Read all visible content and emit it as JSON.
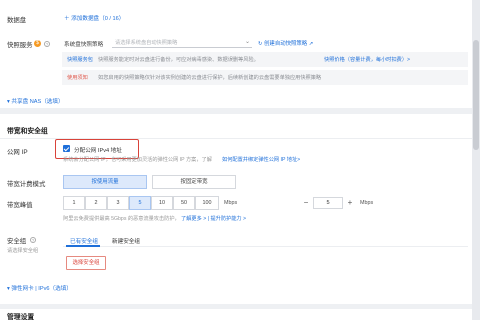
{
  "data_disk": {
    "label": "数据盘",
    "add_button": "添加数据盘（0 / 16）"
  },
  "snapshot": {
    "label": "快照服务",
    "select_label": "系统盘快照策略",
    "select_placeholder": "请选择系统盘自动快照策略",
    "create_link": "创建自动快照策略",
    "note1_tag": "快照服务包",
    "note1_text": "快照服务能定时对云盘进行备份，可应对病毒感染、数据误删等风险。",
    "note1_link": "快照价格（容量计费，每小时扣费）>",
    "note2_tag": "使用须知",
    "note2_text": "如您启用的快照策略仅针对该实例创建的云盘进行保护，后续新创建的云盘需要单独应用快照策略"
  },
  "shared_nas": {
    "label": "共享盘 NAS（选填）"
  },
  "bandwidth": {
    "section_title": "带宽和安全组",
    "public_ip_label": "公网 IP",
    "checkbox_label": "分配公网 IPv4 地址",
    "hint_text": "系统会分配公网 IP，也可采用更加灵活的弹性公网 IP 方案，了解",
    "hint_link": "如何配置并绑定弹性公网 IP 地址>",
    "billing_label": "带宽计费模式",
    "billing_options": [
      "按使用流量",
      "按固定带宽"
    ],
    "peak_label": "带宽峰值",
    "peak_options": [
      "1",
      "2",
      "3",
      "5",
      "10",
      "50",
      "100"
    ],
    "unit": "Mbps",
    "stepper_minus": "−",
    "stepper_value": "5",
    "stepper_plus": "+",
    "stepper_unit": "Mbps",
    "peak_note": "阿里云免费提供最高 5Gbps 的恶意流量攻击防护，",
    "peak_note_link": "了解更多 > | 提升防护能力 >"
  },
  "security_group": {
    "label": "安全组",
    "sublabel": "请选择安全组",
    "tabs": [
      "已有安全组",
      "新建安全组"
    ],
    "select_button": "选择安全组"
  },
  "nic": {
    "label": "弹性网卡 | IPv6（选填）"
  },
  "management": {
    "section_title": "管理设置"
  }
}
